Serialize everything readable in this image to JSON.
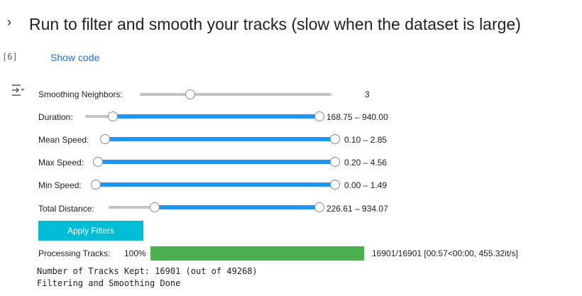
{
  "header": {
    "chevron": "›",
    "title": "Run to filter and smooth your tracks (slow when the dataset is large)"
  },
  "cell": {
    "execution_count": "[6]",
    "show_code_label": "Show code",
    "output_icon": "output-collapse-icon"
  },
  "sliders": {
    "smoothing": {
      "label": "Smoothing Neighbors:",
      "value_text": "3",
      "level_fraction": 0.25
    },
    "duration": {
      "label": "Duration:",
      "value_text": "168.75 – 940.00",
      "range_fraction": [
        0.1,
        1.0
      ]
    },
    "mean_speed": {
      "label": "Mean Speed:",
      "value_text": "0.10 – 2.85",
      "range_fraction": [
        0.0,
        1.0
      ]
    },
    "max_speed": {
      "label": "Max Speed:",
      "value_text": "0.20 – 4.56",
      "range_fraction": [
        0.0,
        1.0
      ]
    },
    "min_speed": {
      "label": "Min Speed:",
      "value_text": "0.00 – 1.49",
      "range_fraction": [
        0.0,
        1.0
      ]
    },
    "total_distance": {
      "label": "Total Distance:",
      "value_text": "226.61 – 934.07",
      "range_fraction": [
        0.2,
        1.0
      ]
    }
  },
  "apply_button": {
    "label": "Apply Filters",
    "color": "#00bcd4"
  },
  "progress": {
    "label": "Processing Tracks:",
    "percent_text": "100%",
    "fraction": 1.0,
    "stats": "16901/16901 [00:57<00:00, 455.32it/s]",
    "color": "#4caf50"
  },
  "output": {
    "line1": "Number of Tracks Kept: 16901 (out of 49268)",
    "line2": "Filtering and Smoothing Done"
  },
  "colors": {
    "slider_fill": "#2196f3",
    "link": "#1a73e8"
  }
}
